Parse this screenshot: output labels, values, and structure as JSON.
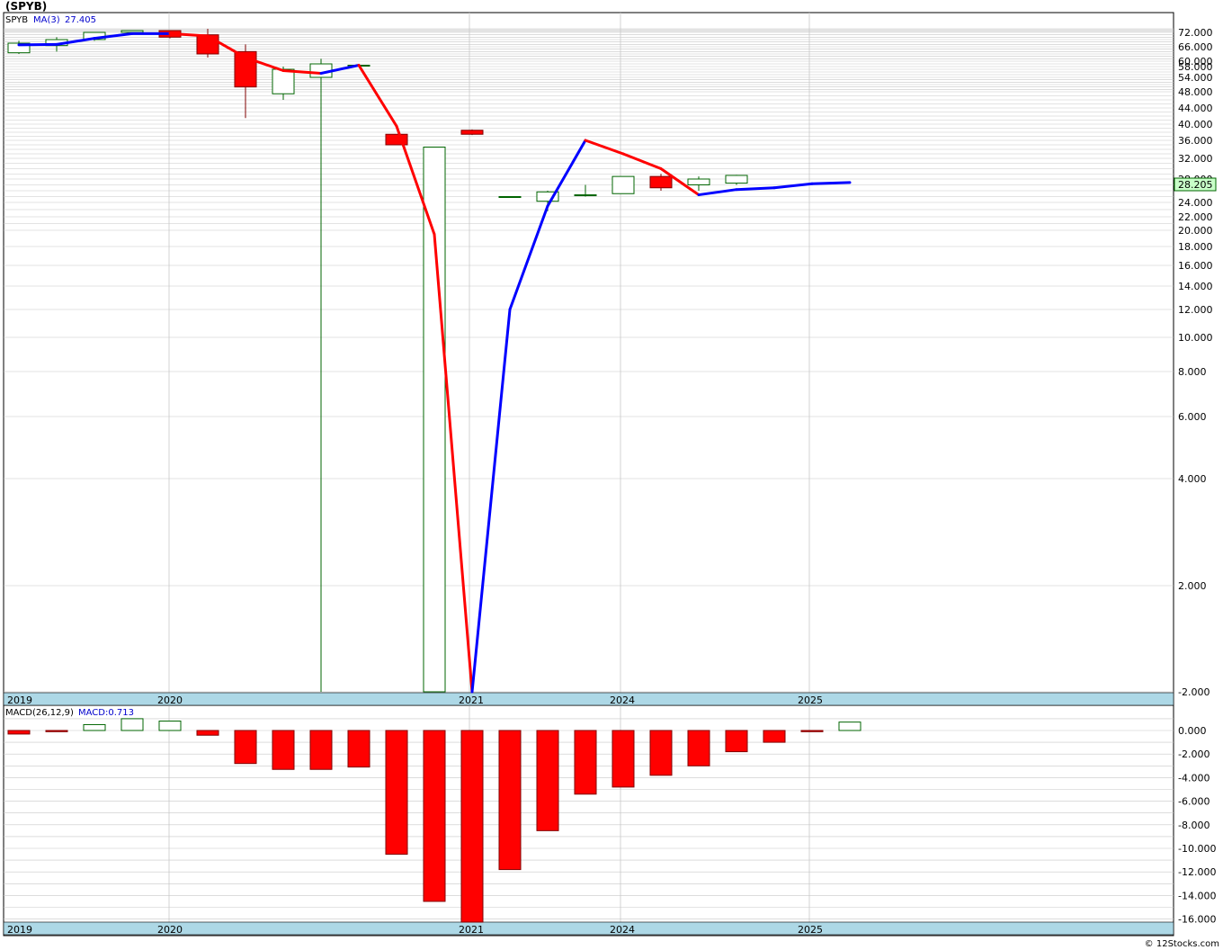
{
  "header": {
    "title": "(SPYB)",
    "legend_symbol": "SPYB",
    "legend_ma_label": "MA(3)",
    "legend_ma_value": "27.405",
    "last_price": "28.205",
    "macd_label": "MACD(26,12,9)",
    "macd_value_label": "MACD:0.713",
    "footer": "© 12Stocks.com"
  },
  "colors": {
    "up_candle_border": "#006400",
    "down_candle_fill": "#ff0000",
    "ma_up": "#0000ff",
    "ma_down": "#ff0000",
    "axis_band": "#add8e6",
    "grid": "#c8c8c8",
    "price_badge": "#c8ffc8"
  },
  "chart_data": [
    {
      "type": "candlestick",
      "title": "(SPYB)",
      "y_scale": "log-like",
      "price_ticks": [
        "72.000",
        "66.000",
        "60.000",
        "58.000",
        "54.000",
        "48.000",
        "44.000",
        "40.000",
        "36.000",
        "32.000",
        "28.000",
        "24.000",
        "22.000",
        "20.000",
        "18.000",
        "16.000",
        "14.000",
        "12.000",
        "10.000",
        "8.000",
        "6.000",
        "4.000",
        "2.000",
        "-2.000"
      ],
      "x_labels": [
        "2019",
        "2020",
        "2021",
        "2024",
        "2025"
      ],
      "candles": [
        {
          "open": 63.5,
          "close": 67.5,
          "high": 68.5,
          "low": 63.0
        },
        {
          "open": 66.5,
          "close": 69.0,
          "high": 70.0,
          "low": 64.0
        },
        {
          "open": 69.0,
          "close": 72.0,
          "high": 72.5,
          "low": 68.5
        },
        {
          "open": 72.0,
          "close": 74.0,
          "high": 74.5,
          "low": 71.0
        },
        {
          "open": 74.0,
          "close": 70.0,
          "high": 74.5,
          "low": 69.5
        },
        {
          "open": 71.0,
          "close": 63.0,
          "high": 76.0,
          "low": 61.5
        },
        {
          "open": 64.0,
          "close": 50.0,
          "high": 67.0,
          "low": 41.5
        },
        {
          "open": 47.5,
          "close": 57.0,
          "high": 58.0,
          "low": 46.0
        },
        {
          "open": 54.0,
          "close": 59.0,
          "high": 61.0,
          "low": -2.0
        },
        {
          "open": 58.5,
          "close": 58.5,
          "high": 58.5,
          "low": 58.5
        },
        {
          "open": 37.5,
          "close": 35.0,
          "high": 37.5,
          "low": 35.0
        },
        {
          "open": -2.0,
          "close": 34.5,
          "high": 34.5,
          "low": -2.0
        },
        {
          "open": 38.5,
          "close": 37.5,
          "high": 38.7,
          "low": 37.3
        },
        {
          "open": 25.0,
          "close": 25.0,
          "high": 25.0,
          "low": 25.0
        },
        {
          "open": 24.2,
          "close": 25.8,
          "high": 26.0,
          "low": 22.8
        },
        {
          "open": 25.2,
          "close": 25.3,
          "high": 27.0,
          "low": 25.0
        },
        {
          "open": 25.5,
          "close": 28.5,
          "high": 28.5,
          "low": 25.5
        },
        {
          "open": 28.5,
          "close": 26.5,
          "high": 29.0,
          "low": 26.0
        },
        {
          "open": 27.0,
          "close": 28.0,
          "high": 28.5,
          "low": 26.0
        },
        {
          "open": 27.3,
          "close": 28.7,
          "high": 28.8,
          "low": 27.0
        }
      ],
      "ma": {
        "name": "MA(3)",
        "points": [
          [
            0,
            66.8
          ],
          [
            1,
            67.0
          ],
          [
            2,
            69.5
          ],
          [
            3,
            71.5
          ],
          [
            4,
            71.5
          ],
          [
            5,
            70.5
          ],
          [
            6,
            61.5
          ],
          [
            7,
            56.5
          ],
          [
            8,
            55.5
          ],
          [
            9,
            58.5
          ],
          [
            10,
            39.5
          ],
          [
            11,
            19.5
          ],
          [
            12,
            -2.0
          ],
          [
            13,
            12.0
          ],
          [
            14,
            23.5
          ],
          [
            15,
            36.0
          ],
          [
            16,
            33.0
          ],
          [
            17,
            30.0
          ],
          [
            18,
            25.3
          ],
          [
            19,
            26.2
          ],
          [
            20,
            26.5
          ],
          [
            21,
            27.2
          ],
          [
            22,
            27.4
          ]
        ]
      }
    },
    {
      "type": "bar",
      "title": "MACD(26,12,9)",
      "y_ticks": [
        "0.000",
        "-2.000",
        "-4.000",
        "-6.000",
        "-8.000",
        "-10.000",
        "-12.000",
        "-14.000",
        "-16.000"
      ],
      "ylim": [
        -16,
        1
      ],
      "values": [
        -0.3,
        -0.1,
        0.5,
        1.0,
        0.8,
        -0.4,
        -2.8,
        -3.3,
        -3.3,
        -3.1,
        -10.5,
        -14.5,
        -16.5,
        -11.8,
        -8.5,
        -5.4,
        -4.8,
        -3.8,
        -3.0,
        -1.8,
        -1.0,
        -0.1,
        0.713
      ]
    }
  ]
}
